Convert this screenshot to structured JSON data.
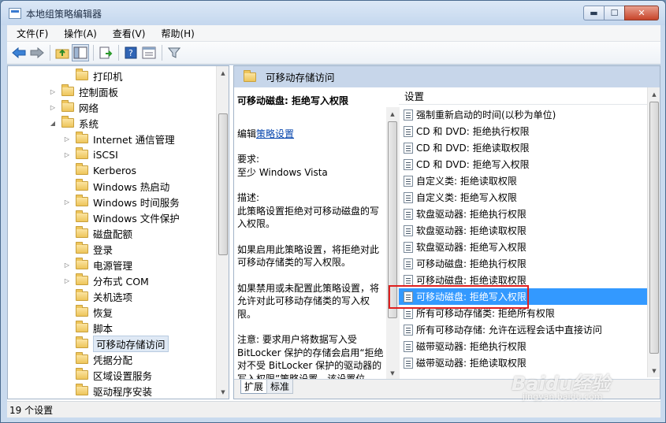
{
  "window": {
    "title": "本地组策略编辑器",
    "buttons": {
      "minimize": "▬",
      "maximize": "☐",
      "close": "✕"
    }
  },
  "menubar": {
    "items": [
      "文件(F)",
      "操作(A)",
      "查看(V)",
      "帮助(H)"
    ]
  },
  "toolbar": {
    "icons": [
      "back-arrow-icon",
      "forward-arrow-icon",
      "up-folder-icon",
      "show-tree-icon",
      "export-list-icon",
      "help-icon",
      "properties-icon",
      "filter-icon"
    ]
  },
  "tree": {
    "items": [
      {
        "label": "打印机",
        "depth": 3,
        "expander": ""
      },
      {
        "label": "控制面板",
        "depth": 2,
        "expander": "▷"
      },
      {
        "label": "网络",
        "depth": 2,
        "expander": "▷"
      },
      {
        "label": "系统",
        "depth": 2,
        "expander": "◢"
      },
      {
        "label": "Internet 通信管理",
        "depth": 3,
        "expander": "▷"
      },
      {
        "label": "iSCSI",
        "depth": 3,
        "expander": "▷"
      },
      {
        "label": "Kerberos",
        "depth": 3,
        "expander": ""
      },
      {
        "label": "Windows 热启动",
        "depth": 3,
        "expander": ""
      },
      {
        "label": "Windows 时间服务",
        "depth": 3,
        "expander": "▷"
      },
      {
        "label": "Windows 文件保护",
        "depth": 3,
        "expander": ""
      },
      {
        "label": "磁盘配额",
        "depth": 3,
        "expander": ""
      },
      {
        "label": "登录",
        "depth": 3,
        "expander": ""
      },
      {
        "label": "电源管理",
        "depth": 3,
        "expander": "▷"
      },
      {
        "label": "分布式 COM",
        "depth": 3,
        "expander": "▷"
      },
      {
        "label": "关机选项",
        "depth": 3,
        "expander": ""
      },
      {
        "label": "恢复",
        "depth": 3,
        "expander": ""
      },
      {
        "label": "脚本",
        "depth": 3,
        "expander": ""
      },
      {
        "label": "可移动存储访问",
        "depth": 3,
        "expander": "",
        "selected": true
      },
      {
        "label": "凭据分配",
        "depth": 3,
        "expander": ""
      },
      {
        "label": "区域设置服务",
        "depth": 3,
        "expander": ""
      },
      {
        "label": "驱动程序安装",
        "depth": 3,
        "expander": ""
      }
    ]
  },
  "right_panel": {
    "header": "可移动存储访问",
    "description": {
      "title": "可移动磁盘: 拒绝写入权限",
      "edit_prefix": "编辑",
      "edit_link": "策略设置",
      "requirements_label": "要求:",
      "requirements_value": "至少 Windows Vista",
      "desc_label": "描述:",
      "desc_text": "此策略设置拒绝对可移动磁盘的写入权限。",
      "enabled_text": "如果启用此策略设置，将拒绝对此可移动存储类的写入权限。",
      "disabled_text": "如果禁用或未配置此策略设置，将允许对此可移动存储类的写入权限。",
      "note_text": "注意: 要求用户将数据写入受 BitLocker 保护的存储会启用“拒绝对不受 BitLocker 保护的驱动器的写入权限”策略设置，该设置位"
    },
    "list": {
      "header": "设置",
      "items": [
        {
          "label": "强制重新启动的时间(以秒为单位)"
        },
        {
          "label": "CD 和 DVD: 拒绝执行权限"
        },
        {
          "label": "CD 和 DVD: 拒绝读取权限"
        },
        {
          "label": "CD 和 DVD: 拒绝写入权限"
        },
        {
          "label": "自定义类: 拒绝读取权限"
        },
        {
          "label": "自定义类: 拒绝写入权限"
        },
        {
          "label": "软盘驱动器: 拒绝执行权限"
        },
        {
          "label": "软盘驱动器: 拒绝读取权限"
        },
        {
          "label": "软盘驱动器: 拒绝写入权限"
        },
        {
          "label": "可移动磁盘: 拒绝执行权限"
        },
        {
          "label": "可移动磁盘: 拒绝读取权限"
        },
        {
          "label": "可移动磁盘: 拒绝写入权限",
          "selected": true
        },
        {
          "label": "所有可移动存储类: 拒绝所有权限"
        },
        {
          "label": "所有可移动存储: 允许在远程会话中直接访问"
        },
        {
          "label": "磁带驱动器: 拒绝执行权限"
        },
        {
          "label": "磁带驱动器: 拒绝读取权限"
        }
      ]
    },
    "tabs": [
      "扩展",
      "标准"
    ],
    "active_tab": "扩展"
  },
  "statusbar": {
    "text": "19 个设置"
  },
  "watermark": {
    "brand": "Baidu经验",
    "sub": "jingyan.baidu.com"
  },
  "colors": {
    "selection": "#3399ff",
    "highlight_border": "#e02020",
    "header_bg": "#c7d6ea",
    "link": "#0645ad"
  }
}
